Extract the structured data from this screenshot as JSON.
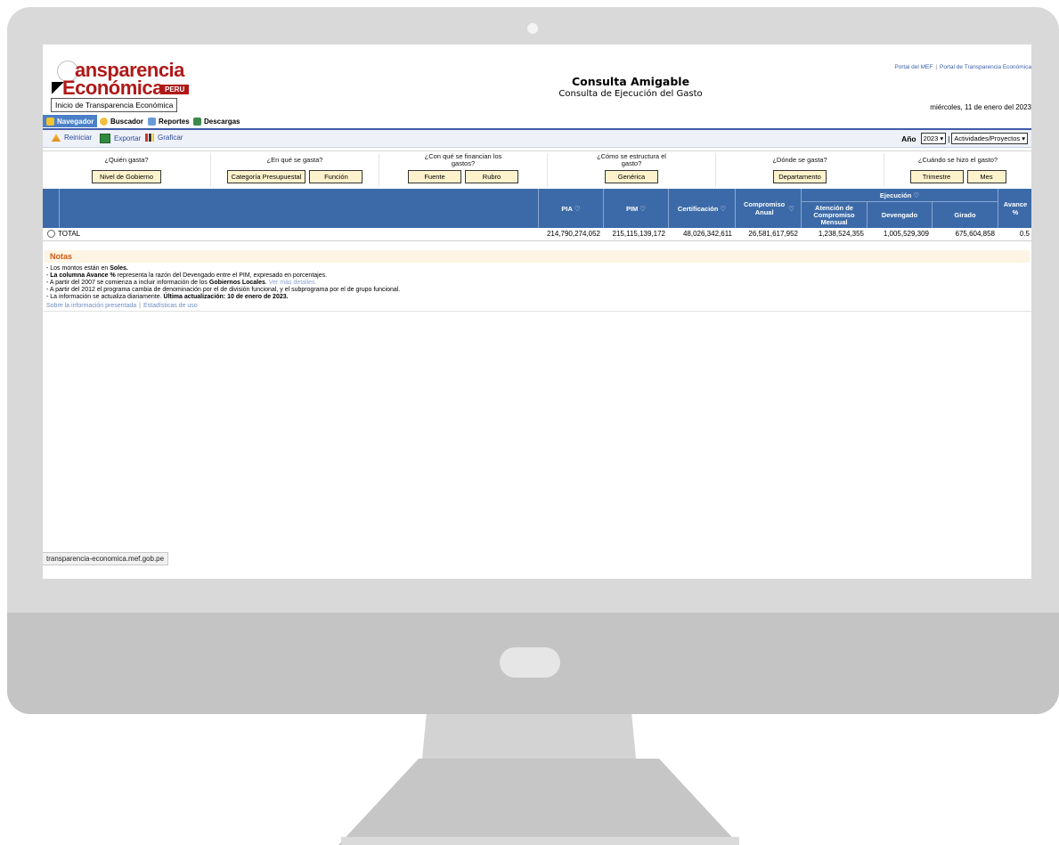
{
  "site": {
    "logo_line1": "ansparencia",
    "logo_line2": "Económica",
    "logo_badge": "PERU",
    "tooltip": "Inicio de Transparencia Económica",
    "title": "Consulta Amigable",
    "subtitle": "Consulta de Ejecución del Gasto",
    "top_links": [
      "Portal del MEF",
      "Portal de Transparencia Económica"
    ],
    "link_separator": "|",
    "date": "miércoles, 11 de enero del 2023"
  },
  "tabs": [
    {
      "label": "Navegador",
      "active": true,
      "icon": "navigator-icon"
    },
    {
      "label": "Buscador",
      "active": false,
      "icon": "search-icon"
    },
    {
      "label": "Reportes",
      "active": false,
      "icon": "report-icon"
    },
    {
      "label": "Descargas",
      "active": false,
      "icon": "download-icon"
    }
  ],
  "toolbar": {
    "reiniciar": "Reiniciar",
    "exportar": "Exportar",
    "graficar": "Graficar",
    "year_label": "Año",
    "year_value": "2023 ▾",
    "separator": "|",
    "view_value": "Actividades/Proyectos ▾"
  },
  "questions": [
    {
      "label": "¿Quién gasta?",
      "buttons": [
        "Nivel de Gobierno"
      ]
    },
    {
      "label": "¿En qué se gasta?",
      "buttons": [
        "Categoría Presupuestal",
        "Función"
      ]
    },
    {
      "label": "¿Con qué se financian los gastos?",
      "buttons": [
        "Fuente",
        "Rubro"
      ]
    },
    {
      "label": "¿Cómo se estructura el gasto?",
      "buttons": [
        "Genérica"
      ]
    },
    {
      "label": "¿Dónde se gasta?",
      "buttons": [
        "Departamento"
      ]
    },
    {
      "label": "¿Cuándo se hizo el gasto?",
      "buttons": [
        "Trimestre",
        "Mes"
      ]
    }
  ],
  "table": {
    "columns": {
      "pia": "PIA",
      "pim": "PIM",
      "certificacion": "Certificación",
      "compromiso": "Compromiso Anual",
      "ejecucion": "Ejecución",
      "atencion": "Atención de Compromiso Mensual",
      "devengado": "Devengado",
      "girado": "Girado",
      "avance": "Avance %"
    },
    "row": {
      "label": "TOTAL",
      "pia": "214,790,274,052",
      "pim": "215,115,139,172",
      "certificacion": "48,026,342,611",
      "compromiso": "26,581,617,952",
      "atencion": "1,238,524,355",
      "devengado": "1,005,529,309",
      "girado": "675,604,858",
      "avance": "0.5"
    }
  },
  "notes": {
    "title": "Notas",
    "lines": [
      {
        "pre": "- Los montos están en ",
        "bold": "Soles.",
        "post": ""
      },
      {
        "pre": "- ",
        "bold": "La columna Avance %",
        "post": " representa la razón del Devengado entre el PIM, expresado en porcentajes."
      },
      {
        "pre": "- A partir del 2007 se comienza a incluir información de los ",
        "bold": "Gobiernos Locales",
        "post": ". ",
        "link": "Ver más detalles."
      },
      {
        "pre": "- A partir del 2012 el programa cambia de denominación por el de división funcional, y el subprograma por el de grupo funcional.",
        "bold": "",
        "post": ""
      },
      {
        "pre": "- La información se actualiza diariamente. ",
        "bold": "Última actualización: 10 de enero de 2023.",
        "post": ""
      }
    ],
    "footer_links": [
      "Sobre la información presentada",
      "Estadísticas de uso"
    ],
    "footer_separator": "|"
  },
  "status_bar": "transparencia-economica.mef.gob.pe",
  "colors": {
    "brand_red": "#b01818",
    "header_blue": "#3c6aa8",
    "button_yellow": "#fdf2cc",
    "notes_orange": "#d05a12"
  }
}
